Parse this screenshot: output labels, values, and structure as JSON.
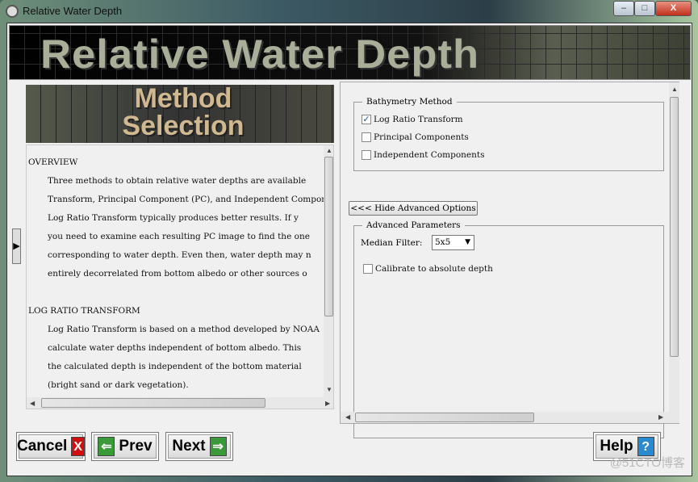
{
  "window": {
    "title": "Relative Water Depth",
    "minimize": "–",
    "maximize": "□",
    "close": "X"
  },
  "banner": {
    "title": "Relative Water Depth"
  },
  "method_image": {
    "line1": "Method",
    "line2": "Selection"
  },
  "help_text": [
    {
      "text": "OVERVIEW",
      "indent": false
    },
    {
      "text": "Three methods to obtain relative water depths are available",
      "indent": true
    },
    {
      "text": "Transform, Principal Component (PC), and Independent Compon",
      "indent": true
    },
    {
      "text": "Log Ratio Transform typically produces better results. If y",
      "indent": true
    },
    {
      "text": "you need to examine each resulting PC image to find the one",
      "indent": true
    },
    {
      "text": "corresponding to water depth.  Even then, water depth may n",
      "indent": true
    },
    {
      "text": "entirely decorrelated from bottom albedo or other sources o",
      "indent": true
    },
    {
      "text": "",
      "indent": false
    },
    {
      "text": "LOG RATIO TRANSFORM",
      "indent": false
    },
    {
      "text": "Log Ratio Transform is based on a method developed by NOAA",
      "indent": true
    },
    {
      "text": "calculate water depths independent of bottom albedo.  This",
      "indent": true
    },
    {
      "text": "the calculated depth is independent of the bottom material",
      "indent": true
    },
    {
      "text": "(bright sand or dark vegetation).",
      "indent": true
    }
  ],
  "bathymetry": {
    "legend": "Bathymetry Method",
    "options": [
      {
        "label": "Log Ratio Transform",
        "checked": true
      },
      {
        "label": "Principal Components",
        "checked": false
      },
      {
        "label": "Independent Components",
        "checked": false
      }
    ]
  },
  "hide_advanced_label": "<<< Hide Advanced Options",
  "advanced": {
    "legend": "Advanced Parameters",
    "median_label": "Median Filter:",
    "median_value": "5x5",
    "calibrate_label": "Calibrate to absolute depth",
    "calibrate_checked": false
  },
  "buttons": {
    "cancel": "Cancel",
    "prev": "Prev",
    "next": "Next",
    "help": "Help"
  },
  "watermark": "@51CTO博客"
}
